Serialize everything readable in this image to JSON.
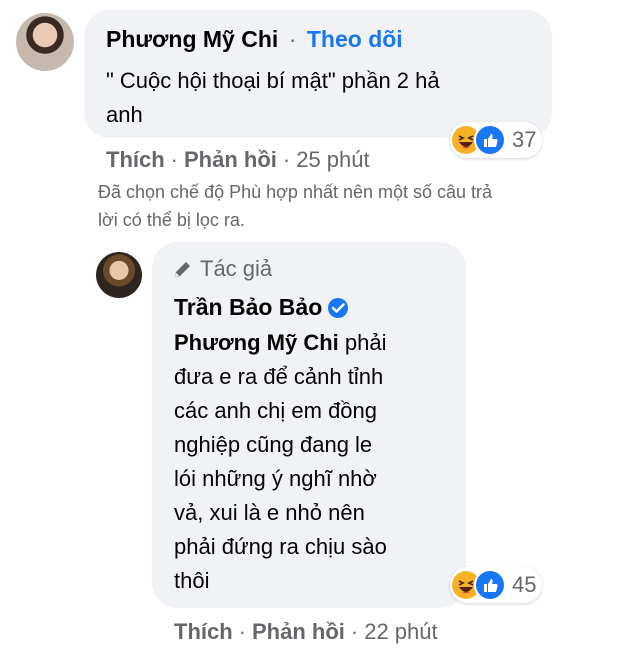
{
  "comment1": {
    "author": "Phương Mỹ Chi",
    "follow_label": "Theo dõi",
    "separator": "·",
    "text_line1": "\" Cuộc hội thoại bí mật\" phần 2 hả",
    "text_line2": "anh",
    "reaction_count": "37",
    "like_label": "Thích",
    "reply_label": "Phản hồi",
    "time": "25 phút"
  },
  "filter_notice": {
    "line1": "Đã chọn chế độ Phù hợp nhất nên một số câu trả",
    "line2": "lời có thể bị lọc ra."
  },
  "reply1": {
    "badge_label": "Tác giả",
    "author": "Trần Bảo Bảo",
    "mention": "Phương Mỹ Chi",
    "text_first": "phải",
    "lines": [
      "đưa e ra để cảnh tỉnh",
      "các anh chị em đồng",
      "nghiệp cũng đang le",
      "lói những ý nghĩ nhờ",
      "vả, xui là e nhỏ nên",
      "phải đứng ra chịu sào",
      "thôi"
    ],
    "reaction_count": "45",
    "like_label": "Thích",
    "reply_label": "Phản hồi",
    "time": "22 phút"
  },
  "colors": {
    "bubble_bg": "#f0f2f5",
    "link_blue": "#1877f2",
    "meta_gray": "#65676b",
    "verified_blue": "#1877f2"
  },
  "icons": [
    "avatar-photo",
    "haha-emoji-icon",
    "like-icon",
    "pencil-icon",
    "verified-badge-icon"
  ]
}
